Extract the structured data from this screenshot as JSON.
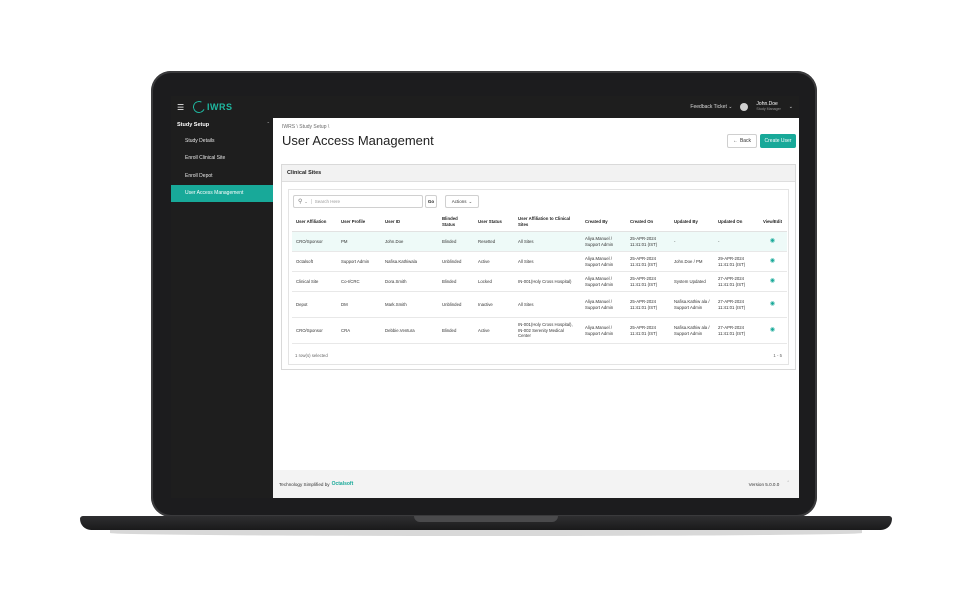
{
  "topbar": {
    "logo_text": "IWRS",
    "feedback_label": "Feedback Ticket",
    "user_name": "John.Doe",
    "user_role": "Study Manager"
  },
  "sidebar": {
    "section_label": "Study Setup",
    "items": [
      {
        "label": "Study Details"
      },
      {
        "label": "Enroll Clinical Site"
      },
      {
        "label": "Enroll Depot"
      },
      {
        "label": "User Access Management"
      }
    ]
  },
  "main": {
    "breadcrumb": [
      "IWRS",
      "Study Setup"
    ],
    "title": "User Access Management",
    "back_label": "Back",
    "create_label": "Create User",
    "card_title": "Clinical Sites",
    "search": {
      "placeholder": "Search Here"
    },
    "go_label": "Go",
    "actions_label": "Actions",
    "table": {
      "columns": [
        "User Affiliation",
        "User Profile",
        "User ID",
        "Blinded Status",
        "User Status",
        "User Affiliation to Clinical Sites",
        "Created By",
        "Created On",
        "Updated By",
        "Updated On",
        "View/Edit"
      ],
      "rows": [
        [
          "CRO/Sponsor",
          "PM",
          "John.Doe",
          "Blinded",
          "Resetted",
          "All Sites",
          "Aliya.Manuel / Support Admin",
          "25-APR-2024 11:41:01 (IST)",
          "-",
          "-"
        ],
        [
          "Octalsoft",
          "Support Admin",
          "Nafisa.Kathiwala",
          "Unblinded",
          "Active",
          "All Sites",
          "Aliya.Manuel / Support Admin",
          "25-APR-2024 11:41:01 (IST)",
          "John.Doe / PM",
          "29-APR-2024 11:41:01 (IST)"
        ],
        [
          "Clinical Site",
          "Co-I/CRC",
          "Dora.Smith",
          "Blinded",
          "Locked",
          "IN-001(Holy Cross Hospital)",
          "Aliya.Manuel / Support Admin",
          "25-APR-2024 11:41:01 (IST)",
          "System Updated",
          "27-APR-2024 11:41:01 (IST)"
        ],
        [
          "Depot",
          "DM",
          "Mark.Smith",
          "Unblinded",
          "Inactive",
          "All Sites",
          "Aliya.Manuel / Support Admin",
          "25-APR-2024 11:41:01 (IST)",
          "Nafisa.Kathiw ala / Support Admin",
          "27-APR-2024 11:41:01 (IST)"
        ],
        [
          "CRO/Sponsor",
          "CRA",
          "Debbie.Ventura",
          "Blinded",
          "Active",
          "IN-001(Holy Cross Hospital), IN-002 Serenity Medical Center",
          "Aliya.Manuel / Support Admin",
          "25-APR-2024 11:41:01 (IST)",
          "Nafisa.Kathiw ala / Support Admin",
          "27-APR-2024 11:41:01 (IST)"
        ]
      ]
    },
    "selected_note": "1 row(s) selected",
    "pager": "1 - 5"
  },
  "footer": {
    "tagline": "Technology Simplified by",
    "brand": "Octalsoft",
    "version": "Version 5.0.0.0"
  },
  "colors": {
    "accent": "#18a999",
    "sidebar_bg": "#1e1e1e",
    "frame": "#1c1c1e"
  }
}
